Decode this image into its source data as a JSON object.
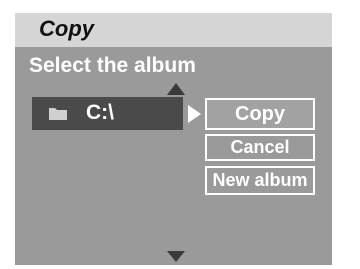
{
  "title": "Copy",
  "heading": "Select the album",
  "folder": {
    "label": "C:\\",
    "icon": "folder-icon"
  },
  "menu": {
    "copy_label": "Copy",
    "cancel_label": "Cancel",
    "new_album_label": "New album"
  },
  "colors": {
    "screen_bg": "#9a9a9a",
    "title_bar_bg": "#d6d6d6",
    "selected_row_bg": "#4a4a4a",
    "text": "#ffffff"
  }
}
